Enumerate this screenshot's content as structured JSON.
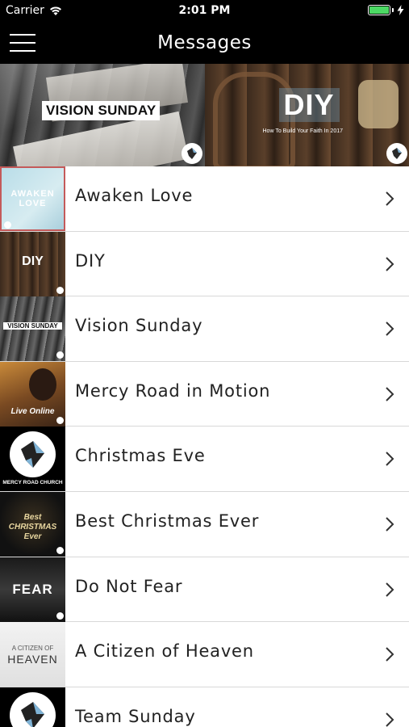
{
  "status_bar": {
    "carrier": "Carrier",
    "time": "2:01 PM",
    "battery_level": 1.0,
    "battery_color": "#4cd964"
  },
  "nav": {
    "title": "Messages",
    "menu_icon": "hamburger-icon"
  },
  "banner": {
    "tiles": [
      {
        "label": "VISION SUNDAY"
      },
      {
        "label": "DIY",
        "subtitle": "How To Build Your Faith In 2017"
      }
    ]
  },
  "thumbs": {
    "awaken": "AWAKEN LOVE",
    "diy": "DIY",
    "vision": "VISION SUNDAY",
    "mercy": "Live Online",
    "christmas": "MERCY ROAD CHURCH",
    "best": "Best CHRISTMAS Ever",
    "fear": "FEAR",
    "citizen_top": "A CITIZEN OF",
    "citizen_bottom": "HEAVEN"
  },
  "messages": [
    {
      "title": "Awaken Love"
    },
    {
      "title": "DIY"
    },
    {
      "title": "Vision Sunday"
    },
    {
      "title": "Mercy Road in Motion"
    },
    {
      "title": "Christmas Eve"
    },
    {
      "title": "Best Christmas Ever"
    },
    {
      "title": "Do Not Fear"
    },
    {
      "title": "A Citizen of Heaven"
    },
    {
      "title": "Team Sunday"
    }
  ],
  "colors": {
    "bar_background": "#000000",
    "list_text": "#222222",
    "divider": "#d8d8d8"
  }
}
